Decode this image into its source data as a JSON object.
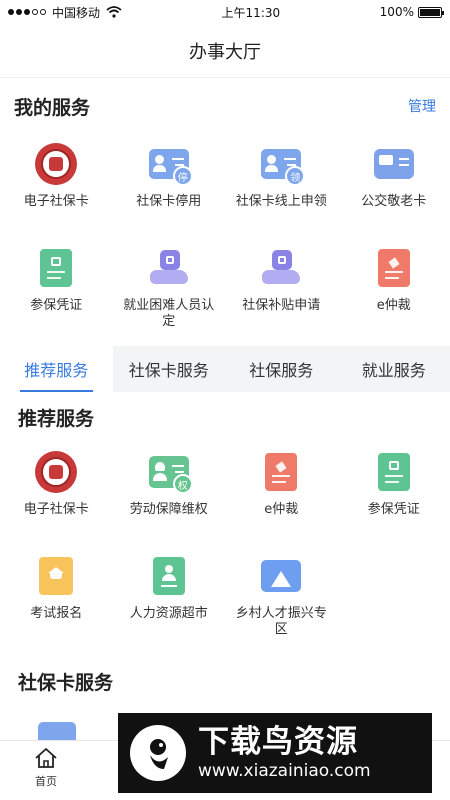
{
  "status_bar": {
    "carrier": "中国移动",
    "time": "上午11:30",
    "battery": "100%",
    "battery_level": 1.0
  },
  "header": {
    "title": "办事大厅"
  },
  "my_services": {
    "title": "我的服务",
    "manage_label": "管理",
    "items": [
      {
        "label": "电子社保卡",
        "icon": "social-security-seal-icon"
      },
      {
        "label": "社保卡停用",
        "icon": "card-stop-icon",
        "badge": "停"
      },
      {
        "label": "社保卡线上申领",
        "icon": "card-apply-icon",
        "badge": "领"
      },
      {
        "label": "公交敬老卡",
        "icon": "bus-card-icon"
      },
      {
        "label": "参保凭证",
        "icon": "certificate-icon"
      },
      {
        "label": "就业困难人员认定",
        "icon": "hand-coin-icon"
      },
      {
        "label": "社保补贴申请",
        "icon": "subsidy-hand-icon"
      },
      {
        "label": "e仲裁",
        "icon": "arbitration-doc-icon"
      }
    ]
  },
  "tabs": [
    {
      "label": "推荐服务",
      "active": true
    },
    {
      "label": "社保卡服务",
      "active": false
    },
    {
      "label": "社保服务",
      "active": false
    },
    {
      "label": "就业服务",
      "active": false
    }
  ],
  "recommended": {
    "title": "推荐服务",
    "items": [
      {
        "label": "电子社保卡",
        "icon": "social-security-seal-icon"
      },
      {
        "label": "劳动保障维权",
        "icon": "worker-rights-icon",
        "badge": "权"
      },
      {
        "label": "e仲裁",
        "icon": "arbitration-doc-icon"
      },
      {
        "label": "参保凭证",
        "icon": "certificate-icon"
      },
      {
        "label": "考试报名",
        "icon": "exam-cap-icon"
      },
      {
        "label": "人力资源超市",
        "icon": "hr-market-icon"
      },
      {
        "label": "乡村人才振兴专区",
        "icon": "mountain-icon"
      }
    ]
  },
  "social_card_section": {
    "title": "社保卡服务"
  },
  "bottom_nav": {
    "home_label": "首页"
  },
  "watermark": {
    "title": "下载鸟资源",
    "url": "www.xiazainiao.com"
  },
  "colors": {
    "accent": "#3a7be0",
    "green": "#5fc493",
    "red": "#ef7a6a",
    "purple": "#8a83e6",
    "yellow": "#f7c35b"
  }
}
